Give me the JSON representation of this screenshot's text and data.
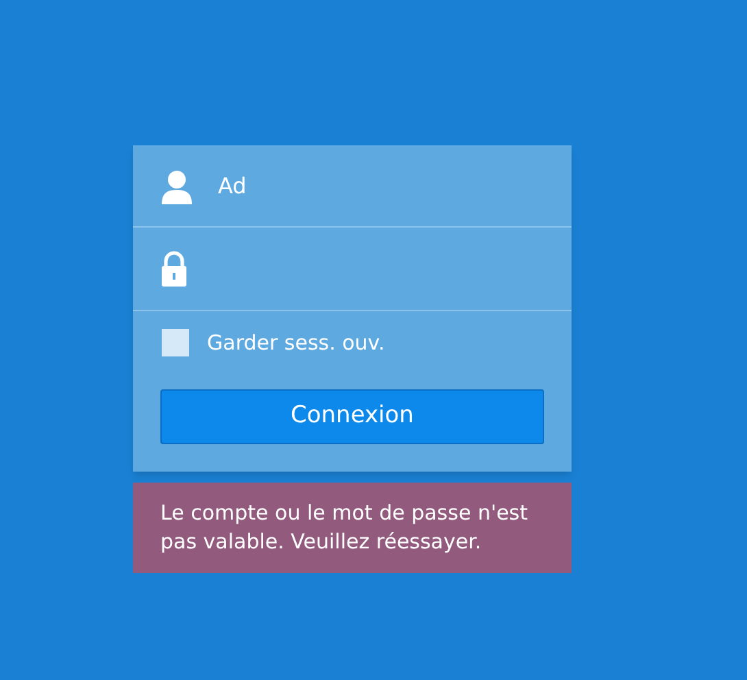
{
  "login": {
    "username": {
      "value": "Ad"
    },
    "remember": {
      "label": "Garder sess. ouv.",
      "checked": false
    },
    "submit": "Connexion"
  },
  "error": "Le compte ou le mot de passe n'est pas valable. Veuillez réessayer."
}
